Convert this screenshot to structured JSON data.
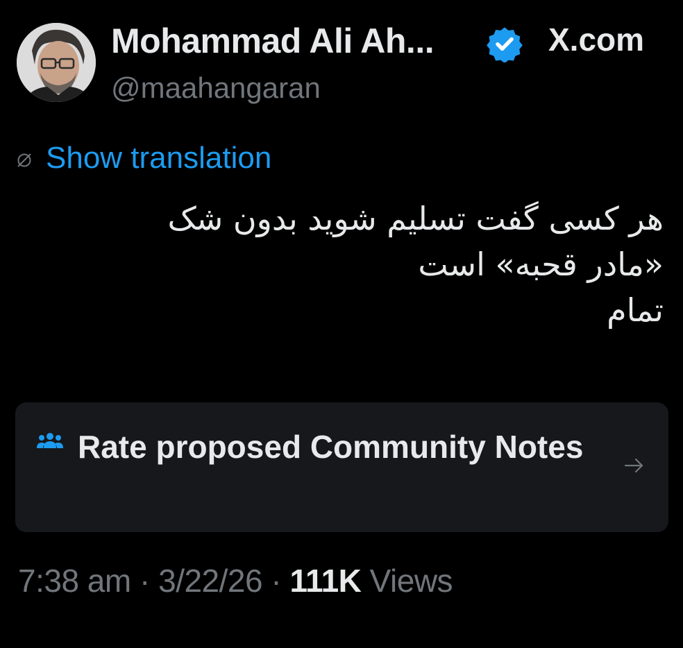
{
  "author": {
    "display_name": "Mohammad Ali Ah...",
    "handle": "@maahangaran",
    "verified_color": "#1d9bf0"
  },
  "source": {
    "label": "X.com"
  },
  "translation": {
    "label": "Show translation"
  },
  "tweet": {
    "lines": [
      "هر کسی گفت تسلیم شوید بدون شک",
      "«مادر قحبه» است",
      "تمام"
    ]
  },
  "community_notes": {
    "label": "Rate proposed Community Notes"
  },
  "meta": {
    "time": "7:38 am",
    "separator": "·",
    "date": "3/22/26",
    "views_count": "111K",
    "views_label": "Views"
  },
  "colors": {
    "background": "#000000",
    "text": "#e7e9ea",
    "muted": "#71767b",
    "link": "#1d9bf0",
    "card": "#16181c"
  }
}
